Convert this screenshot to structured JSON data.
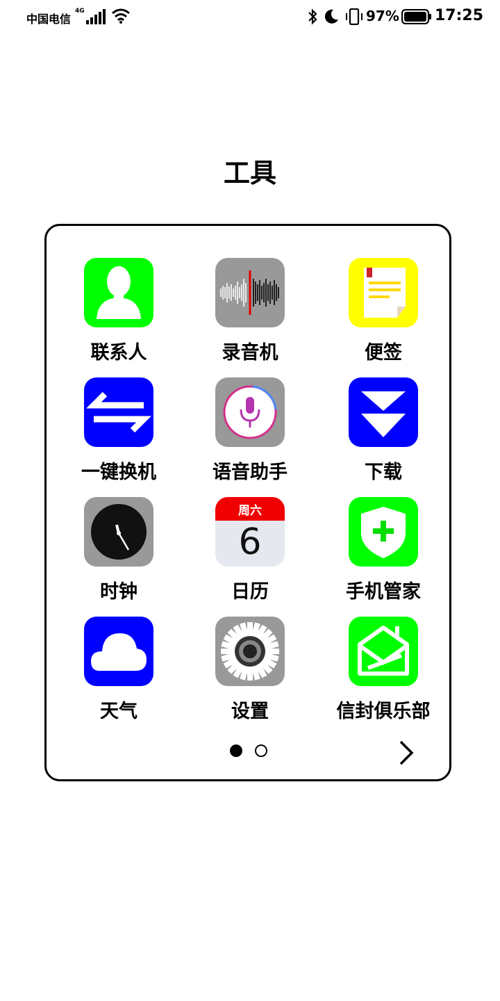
{
  "status_bar": {
    "carrier": "中国电信",
    "network": "4G",
    "battery": "97%",
    "time": "17:25"
  },
  "title": "工具",
  "apps": [
    {
      "label": "联系人",
      "icon": "contacts-icon",
      "color": "#00ff00"
    },
    {
      "label": "录音机",
      "icon": "recorder-icon",
      "color": "#999999"
    },
    {
      "label": "便签",
      "icon": "notes-icon",
      "color": "#ffff00"
    },
    {
      "label": "一键换机",
      "icon": "phone-clone-icon",
      "color": "#0000ff"
    },
    {
      "label": "语音助手",
      "icon": "voice-assistant-icon",
      "color": "#999999"
    },
    {
      "label": "下载",
      "icon": "download-icon",
      "color": "#0000ff"
    },
    {
      "label": "时钟",
      "icon": "clock-icon",
      "color": "#999999"
    },
    {
      "label": "日历",
      "icon": "calendar-icon",
      "color": "#e5e8ee",
      "weekday": "周六",
      "day": "6"
    },
    {
      "label": "手机管家",
      "icon": "phone-manager-icon",
      "color": "#00ff00"
    },
    {
      "label": "天气",
      "icon": "weather-icon",
      "color": "#0000ff"
    },
    {
      "label": "设置",
      "icon": "settings-icon",
      "color": "#999999"
    },
    {
      "label": "信封俱乐部",
      "icon": "envelope-club-icon",
      "color": "#00ff00"
    }
  ],
  "pagination": {
    "current": 1,
    "total": 2
  }
}
